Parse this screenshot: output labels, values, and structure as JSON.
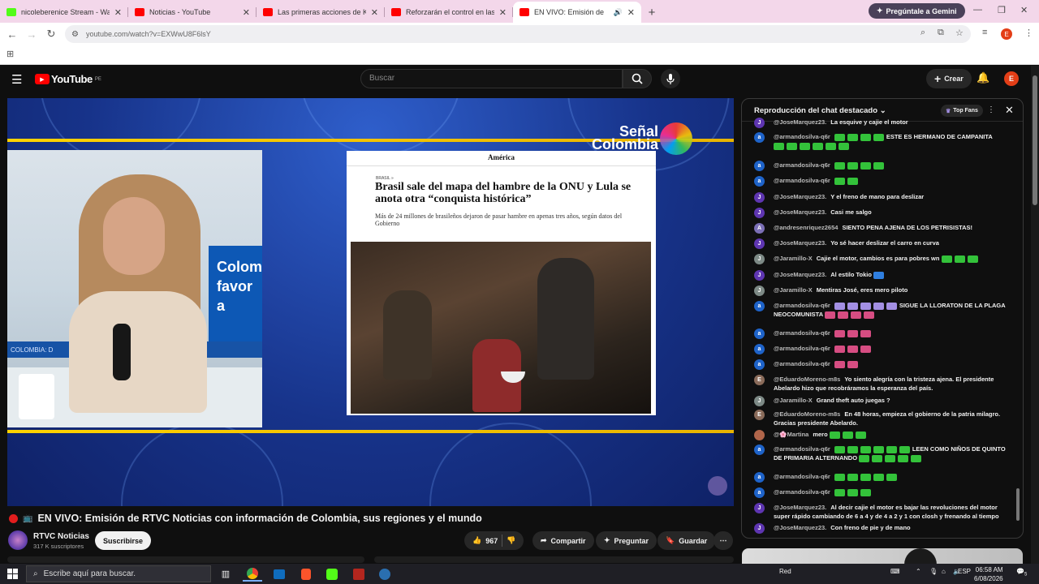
{
  "browser": {
    "tabs": [
      {
        "title": "nicoleberenice Stream - Watch",
        "color": "#53fc18"
      },
      {
        "title": "Noticias - YouTube",
        "color": "#ff0000"
      },
      {
        "title": "Las primeras acciones de Keiko",
        "color": "#ff0000"
      },
      {
        "title": "Reforzarán el control en las fron",
        "color": "#ff0000"
      },
      {
        "title": "EN VIVO: Emisión de",
        "color": "#ff0000"
      }
    ],
    "gemini_label": "Pregúntale a Gemini",
    "url": "youtube.com/watch?v=EXWwU8F6lsY",
    "profile_initial": "E"
  },
  "youtube": {
    "logo_word": "YouTube",
    "logo_region": "PE",
    "search_placeholder": "Buscar",
    "create_label": "Crear",
    "avatar_initial": "E"
  },
  "video": {
    "studio_screen_text": "Colom favor a",
    "desk_text": "COLOMBIA: D",
    "channel_logo_line1": "Señal",
    "channel_logo_line2": "Colombia",
    "article": {
      "section": "América",
      "kicker": "BRASIL »",
      "headline": "Brasil sale del mapa del hambre de la ONU y Lula se anota otra “conquista histórica”",
      "dek": "Más de 24 millones de brasileños dejaron de pasar hambre en apenas tres años, según datos del Gobierno"
    }
  },
  "meta": {
    "title": "EN VIVO: Emisión de RTVC Noticias con información de Colombia, sus regiones y el mundo",
    "channel": "RTVC Noticias",
    "subscribers": "317 K suscriptores",
    "subscribe_label": "Suscribirse",
    "likes": "967",
    "share_label": "Compartir",
    "ask_label": "Preguntar",
    "save_label": "Guardar"
  },
  "chat": {
    "header": "Reproducción del chat destacado",
    "top_fans_label": "Top Fans",
    "messages": [
      {
        "initial": "J",
        "color": "#5e35b1",
        "author": "@JoseMarquez23.",
        "text": "La esquive y cajie el motor",
        "emotes": []
      },
      {
        "initial": "a",
        "color": "#1e63c9",
        "author": "@armandosilva-q6r",
        "text": "ESTE ES HERMANO DE CAMPANITA",
        "emotes": [
          "g",
          "g",
          "g",
          "g"
        ],
        "emotes2": [
          "g",
          "g",
          "g",
          "g",
          "g",
          "g"
        ]
      },
      {
        "initial": "a",
        "color": "#1e63c9",
        "author": "@armandosilva-q6r",
        "text": "",
        "emotes": [
          "g",
          "g",
          "g",
          "g"
        ]
      },
      {
        "initial": "a",
        "color": "#1e63c9",
        "author": "@armandosilva-q6r",
        "text": "",
        "emotes": [
          "g",
          "g"
        ]
      },
      {
        "initial": "J",
        "color": "#5e35b1",
        "author": "@JoseMarquez23.",
        "text": "Y el freno de mano para deslizar",
        "emotes": []
      },
      {
        "initial": "J",
        "color": "#5e35b1",
        "author": "@JoseMarquez23.",
        "text": "Casi me salgo",
        "emotes": []
      },
      {
        "initial": "A",
        "color": "#7b6fb6",
        "author": "@andresenriquez2654",
        "text": "SIENTO PENA AJENA DE LOS PETRISISTAS!",
        "emotes": []
      },
      {
        "initial": "J",
        "color": "#5e35b1",
        "author": "@JoseMarquez23.",
        "text": "Yo sé hacer deslizar el carro en curva",
        "emotes": []
      },
      {
        "initial": "J",
        "color": "#7d8a86",
        "author": "@Jaramillo-X",
        "text": "Cajie el motor, cambios es para pobres wn",
        "emotes_after": [
          "g",
          "g",
          "g"
        ]
      },
      {
        "initial": "J",
        "color": "#5e35b1",
        "author": "@JoseMarquez23.",
        "text": "Al estilo Tokio",
        "emotes_after": [
          "b"
        ]
      },
      {
        "initial": "J",
        "color": "#7d8a86",
        "author": "@Jaramillo-X",
        "text": "Mentiras José, eres mero piloto",
        "emotes": []
      },
      {
        "initial": "a",
        "color": "#1e63c9",
        "author": "@armandosilva-q6r",
        "text": "SIGUE LA LLORATON DE LA PLAGA NEOCOMUNISTA",
        "emotes": [
          "p",
          "p",
          "p",
          "p",
          "p"
        ],
        "emotes_after": [
          "m",
          "m",
          "m",
          "m"
        ]
      },
      {
        "initial": "a",
        "color": "#1e63c9",
        "author": "@armandosilva-q6r",
        "text": "",
        "emotes": [
          "m",
          "m",
          "m"
        ]
      },
      {
        "initial": "a",
        "color": "#1e63c9",
        "author": "@armandosilva-q6r",
        "text": "",
        "emotes": [
          "m",
          "m",
          "m"
        ]
      },
      {
        "initial": "a",
        "color": "#1e63c9",
        "author": "@armandosilva-q6r",
        "text": "",
        "emotes": [
          "m",
          "m"
        ]
      },
      {
        "initial": "E",
        "color": "#8a6b5a",
        "author": "@EduardoMoreno-m8s",
        "text": "Yo siento alegría con la tristeza ajena. El presidente Abelardo hizo que recobráramos la esperanza del país.",
        "emotes": []
      },
      {
        "initial": "J",
        "color": "#7d8a86",
        "author": "@Jaramillo-X",
        "text": "Grand theft auto juegas ?",
        "emotes": []
      },
      {
        "initial": "E",
        "color": "#8a6b5a",
        "author": "@EduardoMoreno-m8s",
        "text": "En 48 horas, empieza el gobierno de la patria milagro. Gracias presidente Abelardo.",
        "emotes": []
      },
      {
        "initial": "",
        "color": "#b0654a",
        "author": "@🌸Martina",
        "text": "mero",
        "emotes_after": [
          "g",
          "g",
          "g"
        ]
      },
      {
        "initial": "a",
        "color": "#1e63c9",
        "author": "@armandosilva-q6r",
        "text": "LEEN COMO NIÑOS DE QUINTO DE PRIMARIA ALTERNANDO",
        "emotes": [
          "g",
          "g",
          "g",
          "g",
          "g",
          "g"
        ],
        "emotes_after": [
          "g",
          "g",
          "g",
          "g",
          "g"
        ]
      },
      {
        "initial": "a",
        "color": "#1e63c9",
        "author": "@armandosilva-q6r",
        "text": "",
        "emotes": [
          "g",
          "g",
          "g",
          "g",
          "g"
        ]
      },
      {
        "initial": "a",
        "color": "#1e63c9",
        "author": "@armandosilva-q6r",
        "text": "",
        "emotes": [
          "g",
          "g",
          "g"
        ]
      },
      {
        "initial": "J",
        "color": "#5e35b1",
        "author": "@JoseMarquez23.",
        "text": "Al decir cajie el motor es bajar las revoluciones del motor super rápido cambiando de 6 a 4 y de 4 a 2 y 1 con closh y frenando al tiempo",
        "emotes": []
      },
      {
        "initial": "J",
        "color": "#5e35b1",
        "author": "@JoseMarquez23.",
        "text": "Con freno de pie y de mano",
        "emotes": []
      }
    ]
  },
  "taskbar": {
    "search_placeholder": "Escribe aquí para buscar.",
    "network_label": "Red",
    "lang": "ESP",
    "time": "06:58 AM",
    "date": "6/08/2026",
    "notif_count": "5"
  }
}
